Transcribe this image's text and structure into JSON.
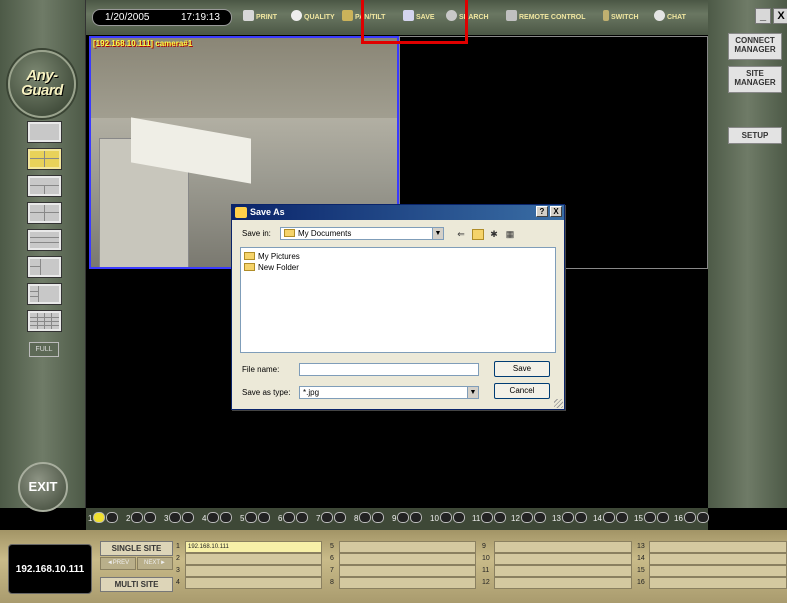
{
  "app": {
    "name": "Any-Guard",
    "logo_line1": "Any-",
    "logo_line2": "Guard"
  },
  "topbar": {
    "date": "1/20/2005",
    "time": "17:19:13",
    "buttons": [
      {
        "label": "PRINT",
        "icon": "printer-icon"
      },
      {
        "label": "QUALITY",
        "icon": "quality-icon"
      },
      {
        "label": "PAN/TILT",
        "icon": "pan-tilt-icon"
      },
      {
        "label": "SAVE",
        "icon": "save-icon"
      },
      {
        "label": "SEARCH",
        "icon": "search-icon"
      },
      {
        "label": "REMOTE CONTROL",
        "icon": "remote-control-icon"
      },
      {
        "label": "SWITCH",
        "icon": "switch-icon"
      },
      {
        "label": "CHAT",
        "icon": "chat-icon"
      }
    ],
    "highlight_color": "#e00000"
  },
  "rightpanel": {
    "minimize": "_",
    "close": "X",
    "connect_manager": "CONNECT MANAGER",
    "site_manager": "SITE MANAGER",
    "setup": "SETUP"
  },
  "leftpanel": {
    "full": "FULL",
    "exit": "EXIT"
  },
  "camera": {
    "label": "[192.168.10.111] camera#1"
  },
  "channels": [
    "1",
    "2",
    "3",
    "4",
    "5",
    "6",
    "7",
    "8",
    "9",
    "10",
    "11",
    "12",
    "13",
    "14",
    "15",
    "16"
  ],
  "bottom": {
    "ip": "192.168.10.111",
    "single_site": "SINGLE SITE",
    "multi_site": "MULTI SITE",
    "prev": "◄PREV",
    "next": "NEXT►",
    "slots": [
      {
        "n": "1",
        "v": "192.168.10.111"
      },
      {
        "n": "2",
        "v": ""
      },
      {
        "n": "3",
        "v": ""
      },
      {
        "n": "4",
        "v": ""
      },
      {
        "n": "5",
        "v": ""
      },
      {
        "n": "6",
        "v": ""
      },
      {
        "n": "7",
        "v": ""
      },
      {
        "n": "8",
        "v": ""
      },
      {
        "n": "9",
        "v": ""
      },
      {
        "n": "10",
        "v": ""
      },
      {
        "n": "11",
        "v": ""
      },
      {
        "n": "12",
        "v": ""
      },
      {
        "n": "13",
        "v": ""
      },
      {
        "n": "14",
        "v": ""
      },
      {
        "n": "15",
        "v": ""
      },
      {
        "n": "16",
        "v": ""
      }
    ]
  },
  "dialog": {
    "title": "Save As",
    "help": "?",
    "close": "X",
    "save_in_label": "Save in:",
    "save_in_value": "My Documents",
    "files": [
      "My Pictures",
      "New Folder"
    ],
    "file_name_label": "File name:",
    "file_name_value": "",
    "save_as_type_label": "Save as type:",
    "save_as_type_value": "*.jpg",
    "save_button": "Save",
    "cancel_button": "Cancel"
  }
}
